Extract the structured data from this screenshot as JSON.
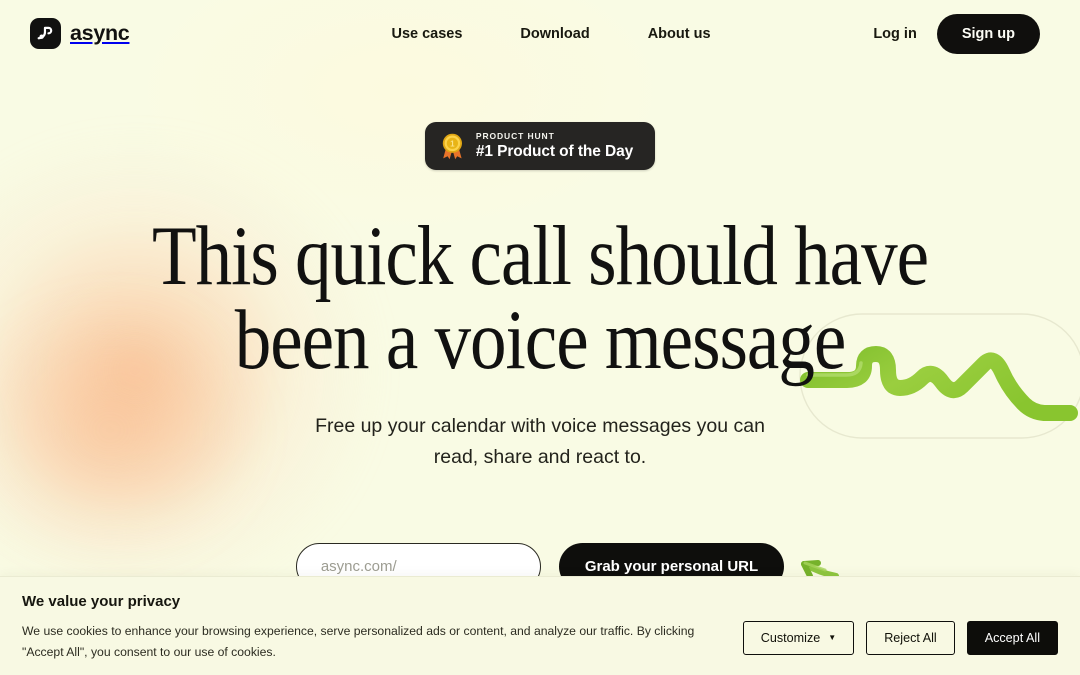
{
  "brand": {
    "name": "async",
    "logo_icon": "async-logo-mark"
  },
  "nav": {
    "items": [
      {
        "label": "Use cases"
      },
      {
        "label": "Download"
      },
      {
        "label": "About us"
      }
    ],
    "login_label": "Log in",
    "signup_label": "Sign up"
  },
  "hero": {
    "badge": {
      "icon": "gold-medal-icon",
      "eyebrow": "PRODUCT HUNT",
      "title": "#1 Product of the Day"
    },
    "heading_line_1": "This quick call should have",
    "heading_line_2": "been a voice message",
    "subheading_line_1": "Free up your calendar with voice messages you",
    "subheading_line_2": "can read, share and react to.",
    "url_placeholder": "async.com/",
    "url_value": "",
    "cta_label": "Grab your personal URL",
    "decoration": {
      "waveform_icon": "green-voice-waveform",
      "arrow_icon": "green-arrow-left-icon"
    }
  },
  "cookie_banner": {
    "title": "We value your privacy",
    "body": "We use cookies to enhance your browsing experience, serve personalized ads or content, and analyze our traffic. By clicking \"Accept All\", you consent to our use of cookies.",
    "customize_label": "Customize",
    "reject_label": "Reject All",
    "accept_label": "Accept All"
  },
  "colors": {
    "page_background": "#f9fbe4",
    "ink": "#111110",
    "accent_green": "#8fc73e",
    "peach_glow": "#fab280",
    "badge_background": "#262523"
  }
}
